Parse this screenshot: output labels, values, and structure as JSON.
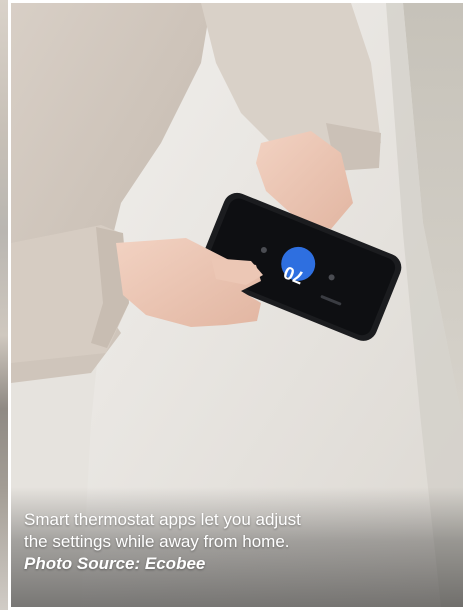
{
  "caption": {
    "line1": "Smart thermostat apps let you adjust",
    "line2": "the settings while away from home.",
    "source": "Photo Source: Ecobee"
  },
  "phone_screen": {
    "temperature": "70"
  }
}
